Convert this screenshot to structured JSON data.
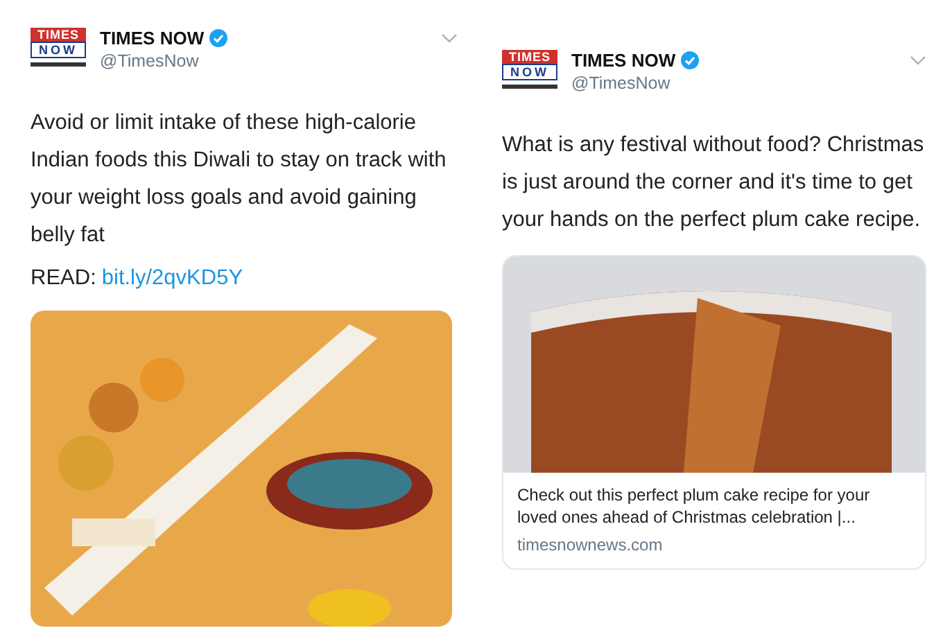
{
  "tweets": [
    {
      "logo": {
        "top": "TIMES",
        "bottom": "NOW"
      },
      "name": "TIMES NOW",
      "verified": true,
      "handle": "@TimesNow",
      "text": "Avoid or limit intake of these high-calorie Indian foods this Diwali to stay on track with your weight loss goals and avoid gaining belly fat",
      "read_label": "READ:",
      "link": "bit.ly/2qvKD5Y",
      "media": {
        "kind": "photo"
      }
    },
    {
      "logo": {
        "top": "TIMES",
        "bottom": "NOW"
      },
      "name": "TIMES NOW",
      "verified": true,
      "handle": "@TimesNow",
      "text": "What is any festival without food? Christmas is just around the corner and it's time to get your hands on the perfect plum cake recipe.",
      "media": {
        "kind": "card",
        "title": "Check out this perfect plum cake recipe for your loved ones ahead of Christmas celebration |...",
        "domain": "timesnownews.com"
      }
    }
  ]
}
